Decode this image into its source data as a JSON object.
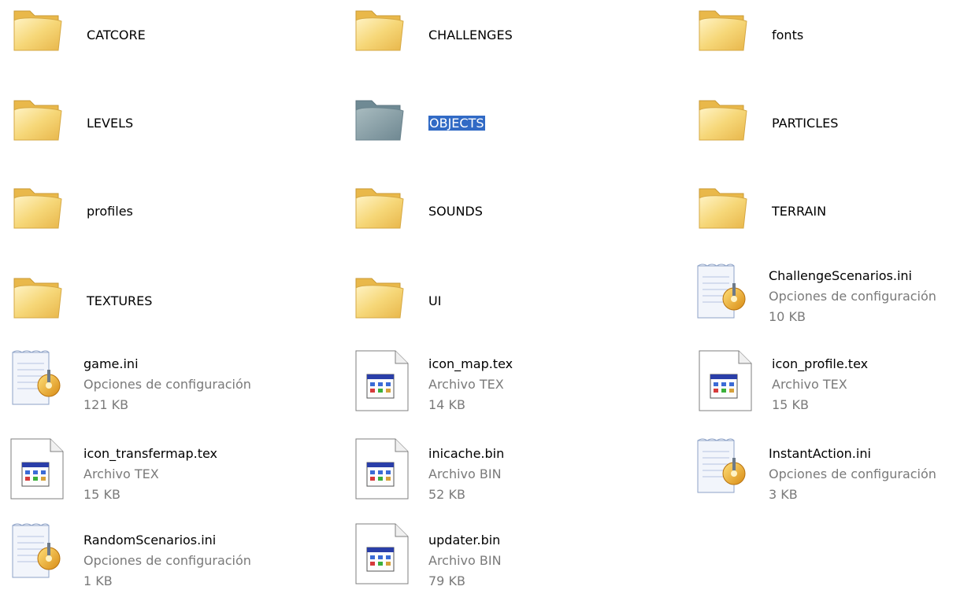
{
  "view": {
    "selected_item": "OBJECTS",
    "colors": {
      "folder_front": "#f6d778",
      "folder_back": "#e9b84a",
      "selected_folder": "#7f9aa3",
      "selection_highlight": "#316ac5",
      "meta_text": "#7a7a7a"
    }
  },
  "folders": [
    {
      "name": "CATCORE",
      "icon": "folder-icon"
    },
    {
      "name": "CHALLENGES",
      "icon": "folder-icon"
    },
    {
      "name": "fonts",
      "icon": "folder-icon"
    },
    {
      "name": "LEVELS",
      "icon": "folder-icon"
    },
    {
      "name": "OBJECTS",
      "icon": "folder-icon",
      "selected": true
    },
    {
      "name": "PARTICLES",
      "icon": "folder-icon"
    },
    {
      "name": "profiles",
      "icon": "folder-icon"
    },
    {
      "name": "SOUNDS",
      "icon": "folder-icon"
    },
    {
      "name": "TERRAIN",
      "icon": "folder-icon"
    },
    {
      "name": "TEXTURES",
      "icon": "folder-icon"
    },
    {
      "name": "UI",
      "icon": "folder-icon"
    }
  ],
  "files": [
    {
      "name": "ChallengeScenarios.ini",
      "type": "Opciones de configuración",
      "size": "10 KB",
      "icon": "config-file-icon"
    },
    {
      "name": "game.ini",
      "type": "Opciones de configuración",
      "size": "121 KB",
      "icon": "config-file-icon"
    },
    {
      "name": "icon_map.tex",
      "type": "Archivo TEX",
      "size": "14 KB",
      "icon": "generic-file-icon"
    },
    {
      "name": "icon_profile.tex",
      "type": "Archivo TEX",
      "size": "15 KB",
      "icon": "generic-file-icon"
    },
    {
      "name": "icon_transfermap.tex",
      "type": "Archivo TEX",
      "size": "15 KB",
      "icon": "generic-file-icon"
    },
    {
      "name": "inicache.bin",
      "type": "Archivo BIN",
      "size": "52 KB",
      "icon": "generic-file-icon"
    },
    {
      "name": "InstantAction.ini",
      "type": "Opciones de configuración",
      "size": "3 KB",
      "icon": "config-file-icon"
    },
    {
      "name": "RandomScenarios.ini",
      "type": "Opciones de configuración",
      "size": "1 KB",
      "icon": "config-file-icon"
    },
    {
      "name": "updater.bin",
      "type": "Archivo BIN",
      "size": "79 KB",
      "icon": "generic-file-icon"
    }
  ]
}
